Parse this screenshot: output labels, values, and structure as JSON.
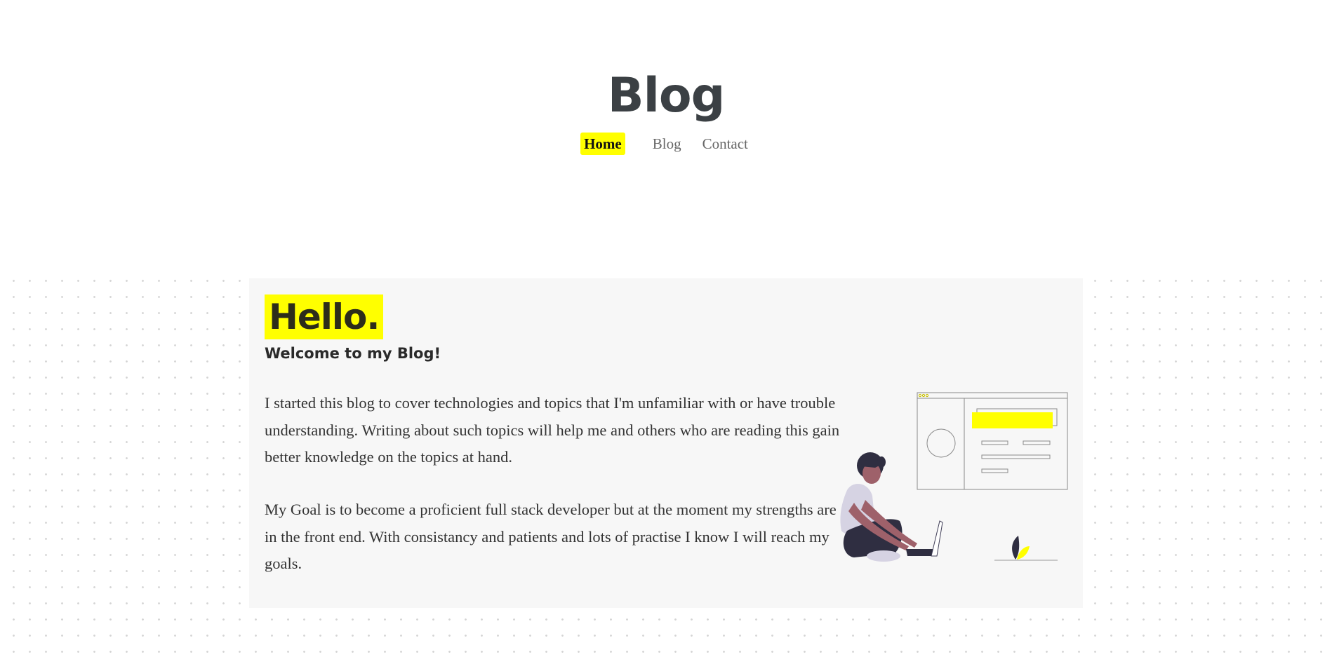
{
  "header": {
    "title": "Blog",
    "nav": [
      {
        "label": "Home",
        "active": true
      },
      {
        "label": "Blog",
        "active": false
      },
      {
        "label": "Contact",
        "active": false
      }
    ]
  },
  "intro": {
    "heading": "Hello.",
    "subheading": "Welcome to my Blog!",
    "paragraphs": [
      "I started this blog to cover technologies and topics that I'm unfamiliar with or have trouble understanding. Writing about such topics will help me and others who are reading this gain better knowledge on the topics at hand.",
      "My Goal is to become a proficient full stack developer but at the moment my strengths are in the front end. With consistancy and patients and lots of practise I know I will reach my goals."
    ],
    "illustration": "person-with-laptop-illustration"
  },
  "colors": {
    "accent": "#ffff00",
    "title": "#3b4044",
    "card_background": "#f7f7f7",
    "nav_text": "#666666"
  }
}
